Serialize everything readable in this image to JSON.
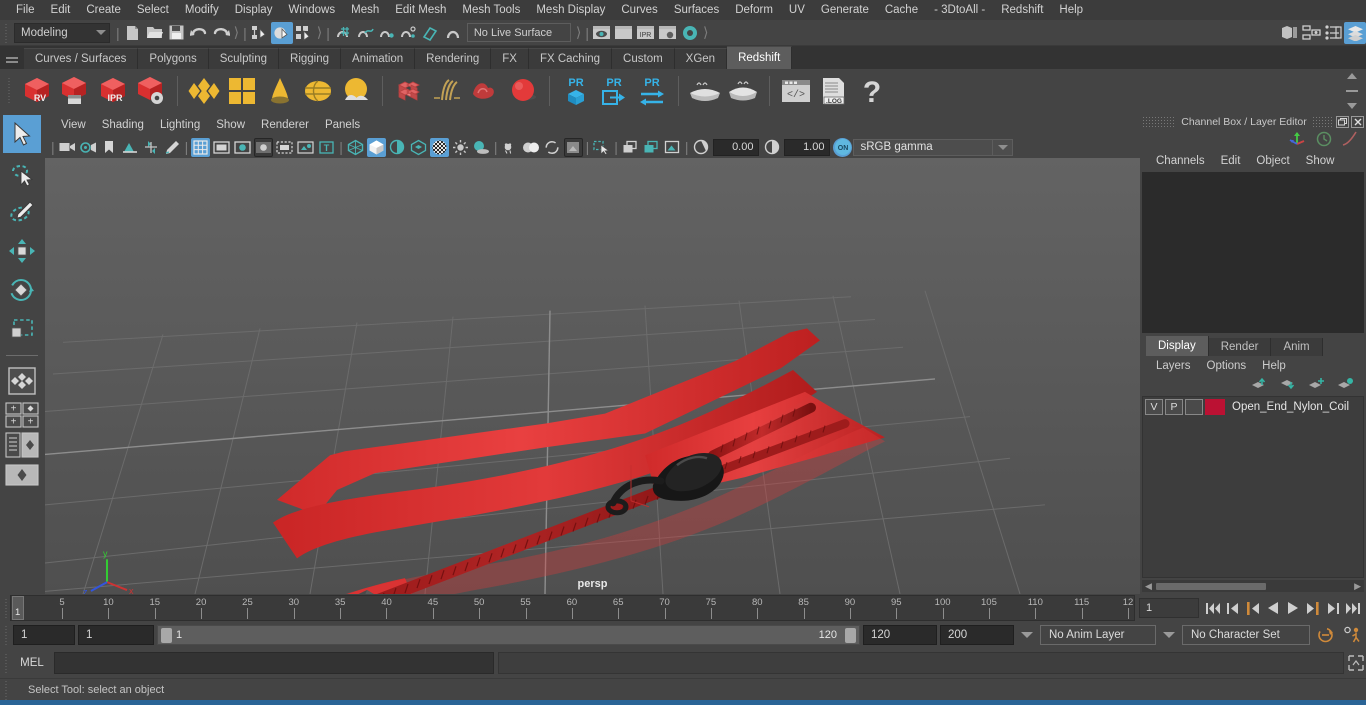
{
  "app": {
    "title": "Autodesk Maya",
    "accent": "#5a9fd4",
    "layer_color": "#bb1133"
  },
  "menubar": {
    "items": [
      "File",
      "Edit",
      "Create",
      "Select",
      "Modify",
      "Display",
      "Windows",
      "Mesh",
      "Edit Mesh",
      "Mesh Tools",
      "Mesh Display",
      "Curves",
      "Surfaces",
      "Deform",
      "UV",
      "Generate",
      "Cache",
      "- 3DtoAll -",
      "Redshift",
      "Help"
    ]
  },
  "statusline": {
    "menuset": "Modeling",
    "live_surface": "No Live Surface",
    "icons": [
      "new-scene-icon",
      "open-scene-icon",
      "save-scene-icon",
      "undo-icon",
      "redo-icon",
      "select-by-hierarchy-icon",
      "select-by-object-icon",
      "select-by-component-icon",
      "snap-to-grid-icon",
      "snap-to-curve-icon",
      "snap-to-point-icon",
      "snap-to-projected-center-icon",
      "snap-to-view-plane-icon",
      "make-live-icon",
      "render-current-frame-icon",
      "render-sequence-icon",
      "ipr-render-icon",
      "render-settings-icon",
      "hypershade-icon",
      "show-hide-editors-icon",
      "show-hide-attribute-editor-icon",
      "show-hide-tool-settings-icon",
      "show-hide-channel-box-icon"
    ]
  },
  "shelf": {
    "tabs": [
      "Curves / Surfaces",
      "Polygons",
      "Sculpting",
      "Rigging",
      "Animation",
      "Rendering",
      "FX",
      "FX Caching",
      "Custom",
      "XGen",
      "Redshift"
    ],
    "selected_tab": "Redshift",
    "buttons": [
      {
        "name": "redshift-render-view",
        "label": "RV"
      },
      {
        "name": "redshift-render-sequence",
        "label": ""
      },
      {
        "name": "redshift-ipr",
        "label": "IPR"
      },
      {
        "name": "redshift-render-settings",
        "label": ""
      },
      {
        "name": "redshift-material-icon",
        "label": ""
      },
      {
        "name": "redshift-material-blend-icon",
        "label": ""
      },
      {
        "name": "redshift-light-icon",
        "label": ""
      },
      {
        "name": "redshift-dome-light-icon",
        "label": ""
      },
      {
        "name": "redshift-environment-icon",
        "label": ""
      },
      {
        "name": "redshift-proxy-icon",
        "label": ""
      },
      {
        "name": "redshift-hair-icon",
        "label": ""
      },
      {
        "name": "redshift-volume-icon",
        "label": ""
      },
      {
        "name": "redshift-sphere-icon",
        "label": ""
      },
      {
        "name": "redshift-pr-object-icon",
        "label": "PR"
      },
      {
        "name": "redshift-pr-export-icon",
        "label": "PR"
      },
      {
        "name": "redshift-pr-transfer-icon",
        "label": "PR"
      },
      {
        "name": "redshift-bake-icon",
        "label": ""
      },
      {
        "name": "redshift-bake-set-icon",
        "label": ""
      },
      {
        "name": "redshift-script-editor-icon",
        "label": ""
      },
      {
        "name": "redshift-log-icon",
        "label": ".LOG"
      },
      {
        "name": "redshift-help-icon",
        "label": "?"
      }
    ]
  },
  "toolbox": {
    "tools": [
      "select-tool",
      "lasso-select-tool",
      "paint-select-tool",
      "move-tool",
      "rotate-tool",
      "scale-tool",
      "last-tool-used",
      "four-view-layout",
      "single-perspective-layout",
      "two-pane-layout",
      "outliner-persp-layout",
      "hypershade-persp-layout"
    ],
    "selected": "select-tool"
  },
  "viewport": {
    "menus": [
      "View",
      "Shading",
      "Lighting",
      "Show",
      "Renderer",
      "Panels"
    ],
    "camera_label": "persp",
    "exposure": "0.00",
    "gamma": "1.00",
    "color_management": "sRGB gamma",
    "color_mgmt_toggle": "ON",
    "toolbar_icons": [
      "select-camera-icon",
      "camera-attributes-icon",
      "bookmarks-icon",
      "image-plane-icon",
      "2d-pan-zoom-icon",
      "grease-pencil-icon",
      "grid-toggle-icon",
      "film-gate-icon",
      "resolution-gate-icon",
      "gate-mask-icon",
      "film-origin-icon",
      "xray-icon",
      "xray-joints-icon",
      "wireframe-icon",
      "smooth-shade-icon",
      "shaded-wireframe-icon",
      "textured-icon",
      "lights-icon",
      "shadows-icon",
      "screen-space-ao-icon",
      "motion-blur-icon",
      "multisample-icon",
      "depth-of-field-icon",
      "isolate-select-icon",
      "viewport-snapshot-icon",
      "grab-viewport-icon",
      "viewport-render-icon",
      "exposure-icon",
      "gamma-icon",
      "color-management-toggle"
    ]
  },
  "channelbox": {
    "panel_title": "Channel Box / Layer Editor",
    "menus": [
      "Channels",
      "Edit",
      "Object",
      "Show"
    ],
    "top_icons": [
      "manipulator-icon",
      "clock-icon",
      "curve-icon"
    ],
    "window_buttons": [
      "undock-icon",
      "close-icon"
    ]
  },
  "layereditor": {
    "tabs": [
      "Display",
      "Render",
      "Anim"
    ],
    "selected_tab": "Display",
    "menus": [
      "Layers",
      "Options",
      "Help"
    ],
    "toolbar_icons": [
      "move-layer-up-icon",
      "move-layer-down-icon",
      "new-layer-icon",
      "new-layer-from-selected-icon"
    ],
    "layers": [
      {
        "visibility": "V",
        "playback": "P",
        "type": "",
        "color": "#bb1133",
        "name": "Open_End_Nylon_Coil"
      }
    ]
  },
  "timeslider": {
    "current_frame": "1",
    "frame_field": "1",
    "ticks": [
      5,
      10,
      15,
      20,
      25,
      30,
      35,
      40,
      45,
      50,
      55,
      60,
      65,
      70,
      75,
      80,
      85,
      90,
      95,
      100,
      105,
      110,
      115,
      120
    ],
    "tick_last_partial": "12",
    "start": 1,
    "end": 120,
    "playback_icons": [
      "go-to-start-icon",
      "step-back-keyframe-icon",
      "step-back-frame-icon",
      "play-backwards-icon",
      "play-forwards-icon",
      "step-forward-frame-icon",
      "step-forward-keyframe-icon",
      "go-to-end-icon"
    ]
  },
  "rangeslider": {
    "anim_start": "1",
    "range_start": "1",
    "bar_min": "1",
    "bar_max": "120",
    "range_end": "120",
    "anim_end": "200",
    "anim_layer": "No Anim Layer",
    "character_set": "No Character Set",
    "right_icons": [
      "auto-keyframe-icon",
      "animation-preferences-icon"
    ]
  },
  "commandline": {
    "language_label": "MEL",
    "input_value": "",
    "output_value": "",
    "script-editor-icon": "script-editor-icon"
  },
  "helpline": {
    "message": "Select Tool: select an object"
  }
}
